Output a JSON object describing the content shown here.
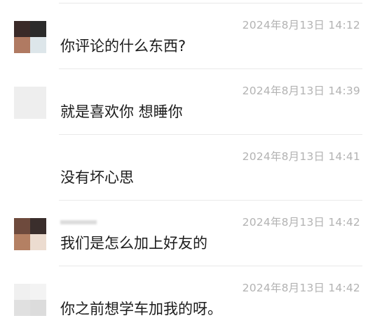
{
  "comments": [
    {
      "timestamp": "2024年8月13日 14:12",
      "text": "你评论的什么东西?",
      "avatar_tiles": [
        "#3a2a28",
        "#2b2b2b",
        "#b07a62",
        "#dde6ea"
      ]
    },
    {
      "timestamp": "2024年8月13日 14:39",
      "text": "就是喜欢你 想睡你",
      "avatar_tiles": [
        "#eeeeee",
        "#eeeeee",
        "#eeeeee",
        "#eeeeee"
      ]
    },
    {
      "timestamp": "2024年8月13日 14:41",
      "text": "没有坏心思",
      "avatar_tiles": [
        "#ffffff",
        "#ffffff",
        "#ffffff",
        "#ffffff"
      ]
    },
    {
      "timestamp": "2024年8月13日 14:42",
      "text": "我们是怎么加上好友的",
      "avatar_tiles": [
        "#6e4a3d",
        "#3a2e2c",
        "#b48063",
        "#ecdcd0"
      ]
    },
    {
      "timestamp": "2024年8月13日 14:42",
      "text": "你之前想学车加我的呀。",
      "avatar_tiles": [
        "#f0f0f0",
        "#f3f3f3",
        "#e0e0e0",
        "#dcdcdc"
      ]
    }
  ]
}
